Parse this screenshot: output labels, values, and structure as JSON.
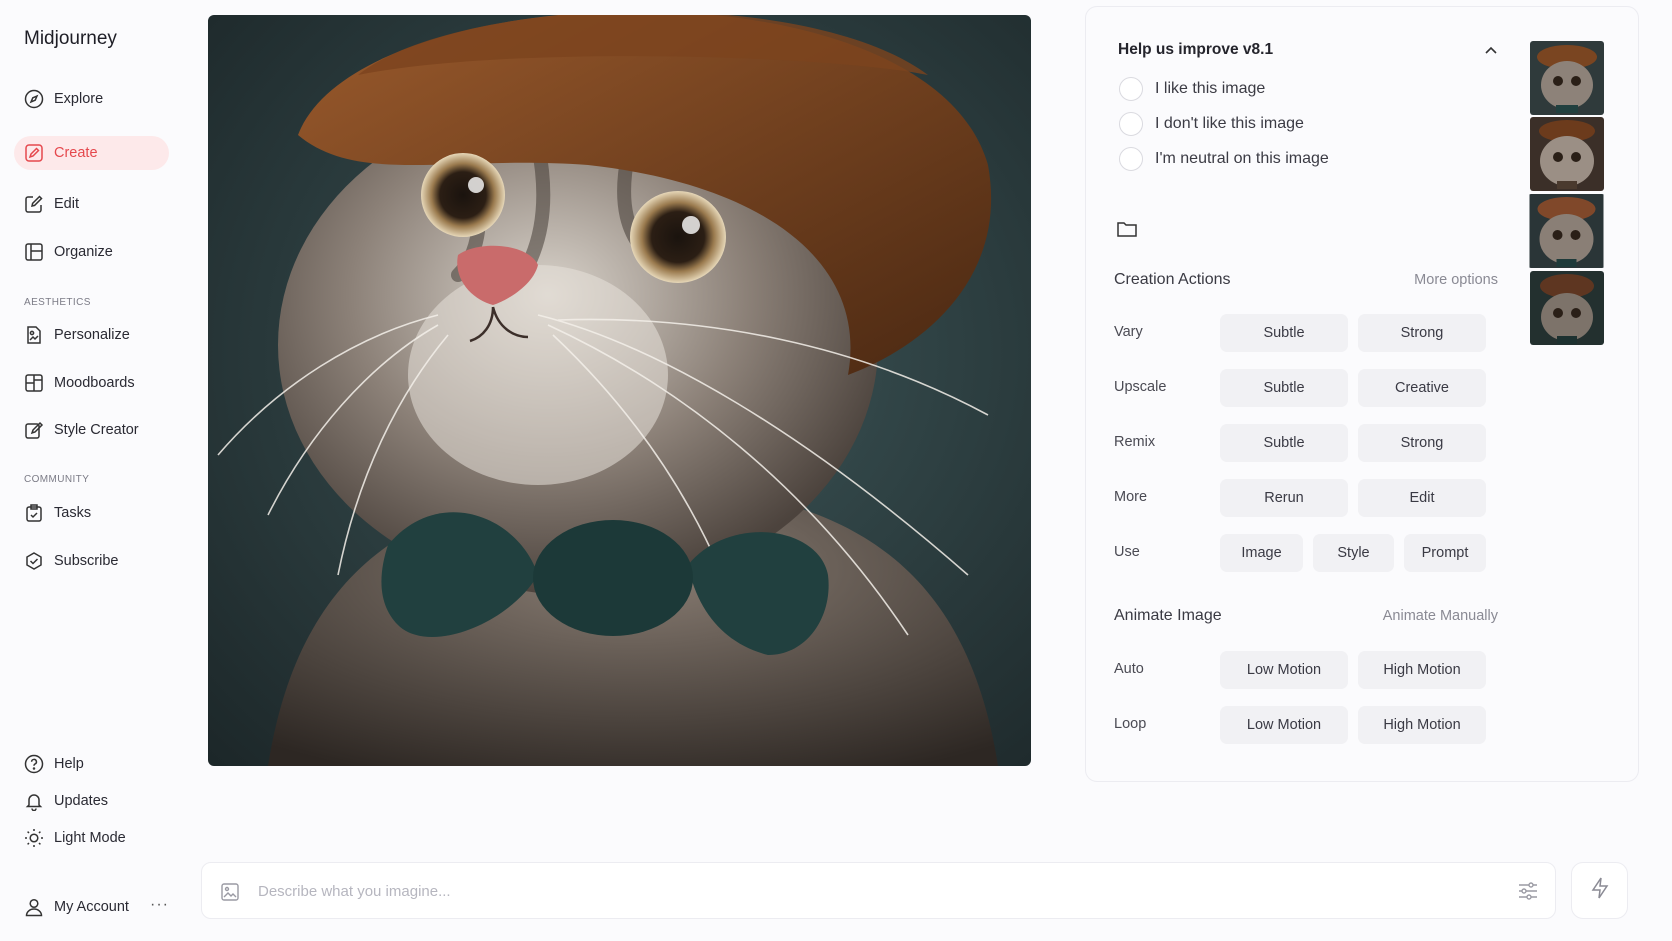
{
  "brand": "Midjourney",
  "nav": {
    "explore": "Explore",
    "create": "Create",
    "edit": "Edit",
    "organize": "Organize",
    "aesthetics_label": "AESTHETICS",
    "personalize": "Personalize",
    "moodboards": "Moodboards",
    "style_creator": "Style Creator",
    "community_label": "COMMUNITY",
    "tasks": "Tasks",
    "subscribe": "Subscribe",
    "help": "Help",
    "updates": "Updates",
    "light_mode": "Light Mode",
    "my_account": "My Account",
    "more": "···"
  },
  "feedback": {
    "title": "Help us improve v8.1",
    "options": [
      "I like this image",
      "I don't like this image",
      "I'm neutral on this image"
    ]
  },
  "creation_actions": {
    "heading": "Creation Actions",
    "more_options": "More options",
    "rows": [
      {
        "label": "Vary",
        "buttons": [
          "Subtle",
          "Strong"
        ]
      },
      {
        "label": "Upscale",
        "buttons": [
          "Subtle",
          "Creative"
        ]
      },
      {
        "label": "Remix",
        "buttons": [
          "Subtle",
          "Strong"
        ]
      },
      {
        "label": "More",
        "buttons": [
          "Rerun",
          "Edit"
        ]
      },
      {
        "label": "Use",
        "buttons": [
          "Image",
          "Style",
          "Prompt"
        ]
      }
    ]
  },
  "animate": {
    "heading": "Animate Image",
    "manual": "Animate Manually",
    "rows": [
      {
        "label": "Auto",
        "buttons": [
          "Low Motion",
          "High Motion"
        ]
      },
      {
        "label": "Loop",
        "buttons": [
          "Low Motion",
          "High Motion"
        ]
      }
    ]
  },
  "prompt": {
    "placeholder": "Describe what you imagine..."
  },
  "colors": {
    "accent": "#e5484d",
    "active_bg": "#fde9ea",
    "button_bg": "#f1f1f4"
  },
  "icons": [
    "compass-icon",
    "create-icon",
    "edit-icon",
    "organize-icon",
    "personalize-icon",
    "moodboards-icon",
    "style-creator-icon",
    "tasks-icon",
    "subscribe-icon",
    "help-icon",
    "bell-icon",
    "sun-icon",
    "user-icon",
    "chevron-up-icon",
    "folder-icon",
    "image-icon",
    "sliders-icon",
    "bolt-icon"
  ]
}
